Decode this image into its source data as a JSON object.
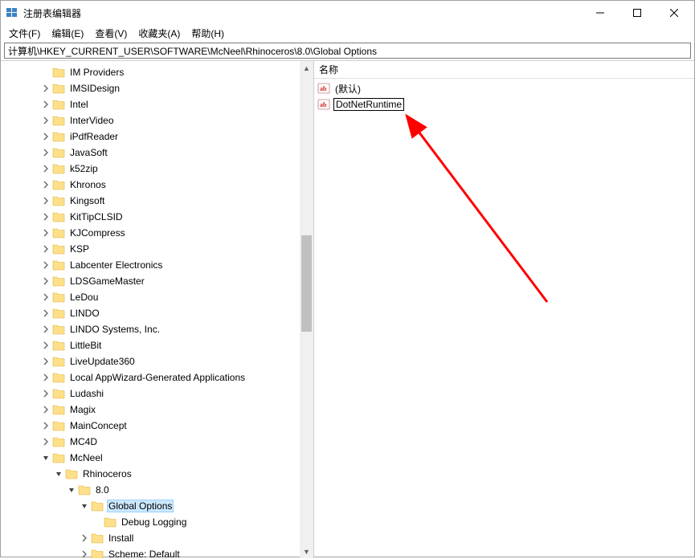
{
  "window": {
    "title": "注册表编辑器"
  },
  "menubar": {
    "file": "文件(F)",
    "edit": "编辑(E)",
    "view": "查看(V)",
    "favorites": "收藏夹(A)",
    "help": "帮助(H)"
  },
  "addressbar": {
    "path": "计算机\\HKEY_CURRENT_USER\\SOFTWARE\\McNeel\\Rhinoceros\\8.0\\Global Options"
  },
  "tree": {
    "items": [
      {
        "indent": 3,
        "tw": "",
        "label": "IM Providers"
      },
      {
        "indent": 3,
        "tw": ">",
        "label": "IMSIDesign"
      },
      {
        "indent": 3,
        "tw": ">",
        "label": "Intel"
      },
      {
        "indent": 3,
        "tw": ">",
        "label": "InterVideo"
      },
      {
        "indent": 3,
        "tw": ">",
        "label": "iPdfReader"
      },
      {
        "indent": 3,
        "tw": ">",
        "label": "JavaSoft"
      },
      {
        "indent": 3,
        "tw": ">",
        "label": "k52zip"
      },
      {
        "indent": 3,
        "tw": ">",
        "label": "Khronos"
      },
      {
        "indent": 3,
        "tw": ">",
        "label": "Kingsoft"
      },
      {
        "indent": 3,
        "tw": ">",
        "label": "KitTipCLSID"
      },
      {
        "indent": 3,
        "tw": ">",
        "label": "KJCompress"
      },
      {
        "indent": 3,
        "tw": ">",
        "label": "KSP"
      },
      {
        "indent": 3,
        "tw": ">",
        "label": "Labcenter Electronics"
      },
      {
        "indent": 3,
        "tw": ">",
        "label": "LDSGameMaster"
      },
      {
        "indent": 3,
        "tw": ">",
        "label": "LeDou"
      },
      {
        "indent": 3,
        "tw": ">",
        "label": "LINDO"
      },
      {
        "indent": 3,
        "tw": ">",
        "label": "LINDO Systems, Inc."
      },
      {
        "indent": 3,
        "tw": ">",
        "label": "LittleBit"
      },
      {
        "indent": 3,
        "tw": ">",
        "label": "LiveUpdate360"
      },
      {
        "indent": 3,
        "tw": ">",
        "label": "Local AppWizard-Generated Applications"
      },
      {
        "indent": 3,
        "tw": ">",
        "label": "Ludashi"
      },
      {
        "indent": 3,
        "tw": ">",
        "label": "Magix"
      },
      {
        "indent": 3,
        "tw": ">",
        "label": "MainConcept"
      },
      {
        "indent": 3,
        "tw": ">",
        "label": "MC4D"
      },
      {
        "indent": 3,
        "tw": "v",
        "label": "McNeel"
      },
      {
        "indent": 4,
        "tw": "v",
        "label": "Rhinoceros"
      },
      {
        "indent": 5,
        "tw": "v",
        "label": "8.0"
      },
      {
        "indent": 6,
        "tw": "v",
        "label": "Global Options",
        "selected": true
      },
      {
        "indent": 7,
        "tw": "",
        "label": "Debug Logging"
      },
      {
        "indent": 6,
        "tw": ">",
        "label": "Install"
      },
      {
        "indent": 6,
        "tw": ">",
        "label": "Scheme: Default"
      }
    ]
  },
  "list": {
    "header_name": "名称",
    "rows": [
      {
        "icon": "string",
        "name": "(默认)",
        "editing": false
      },
      {
        "icon": "string",
        "name": "DotNetRuntime",
        "editing": true
      }
    ]
  }
}
